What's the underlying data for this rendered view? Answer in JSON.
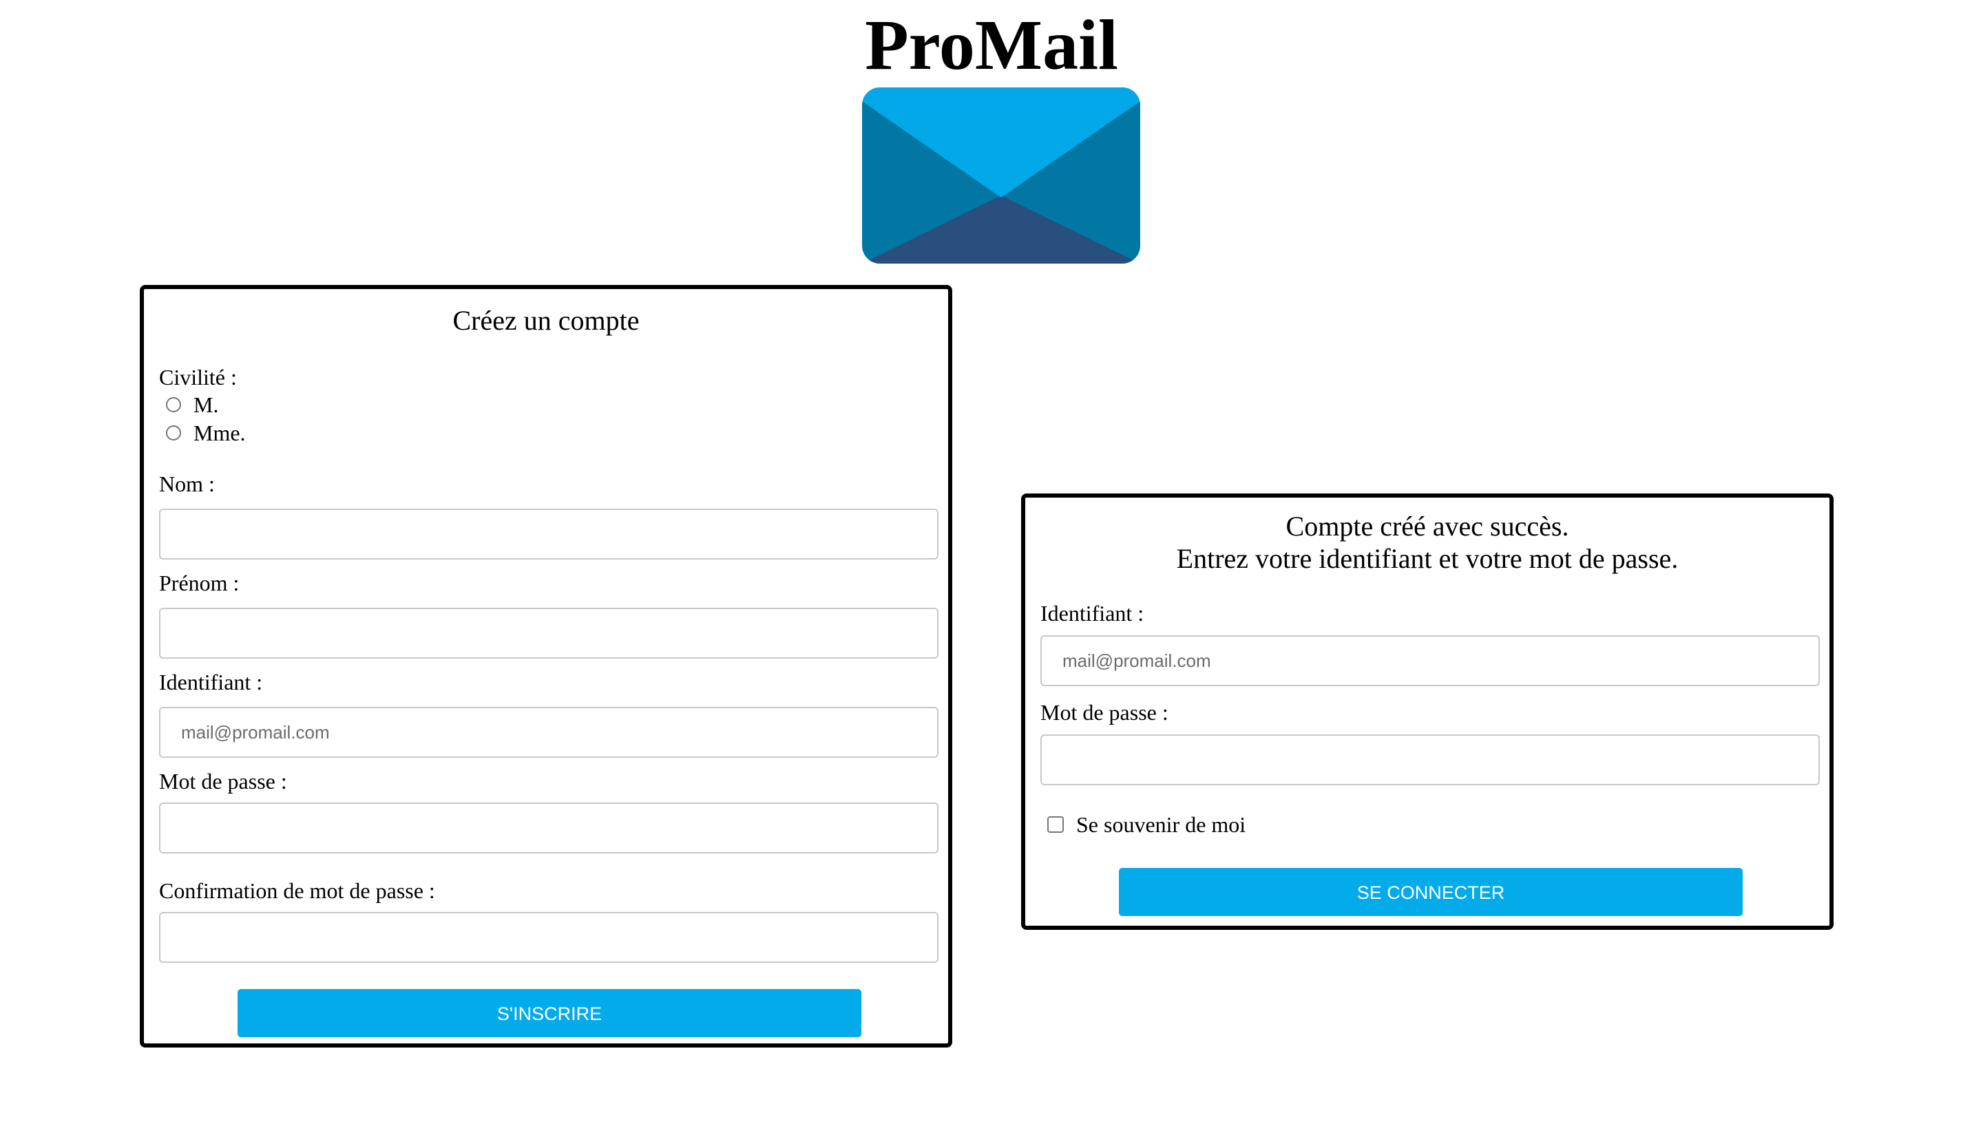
{
  "app": {
    "title": "ProMail"
  },
  "colors": {
    "accent": "#03abeb",
    "logo_top_flap": "#02a8e8",
    "logo_sides": "#0277a4",
    "logo_bottom": "#284f7e"
  },
  "logo": {
    "icon": "envelope-icon"
  },
  "signup": {
    "title": "Créez un compte",
    "civility_label": "Civilité :",
    "civility_options": [
      "M.",
      "Mme."
    ],
    "last_name_label": "Nom :",
    "last_name_value": "",
    "first_name_label": "Prénom :",
    "first_name_value": "",
    "username_label": "Identifiant :",
    "username_placeholder": "mail@promail.com",
    "password_label": "Mot de passe :",
    "password_value": "",
    "confirm_label": "Confirmation de mot de passe :",
    "confirm_value": "",
    "submit_label": "S'inscrire"
  },
  "login": {
    "title_line1": "Compte créé avec succès.",
    "title_line2": "Entrez votre identifiant et votre mot de passe.",
    "username_label": "Identifiant :",
    "username_placeholder": "mail@promail.com",
    "password_label": "Mot de passe :",
    "password_value": "",
    "remember_label": "Se souvenir de moi",
    "remember_checked": false,
    "submit_label": "Se connecter"
  }
}
